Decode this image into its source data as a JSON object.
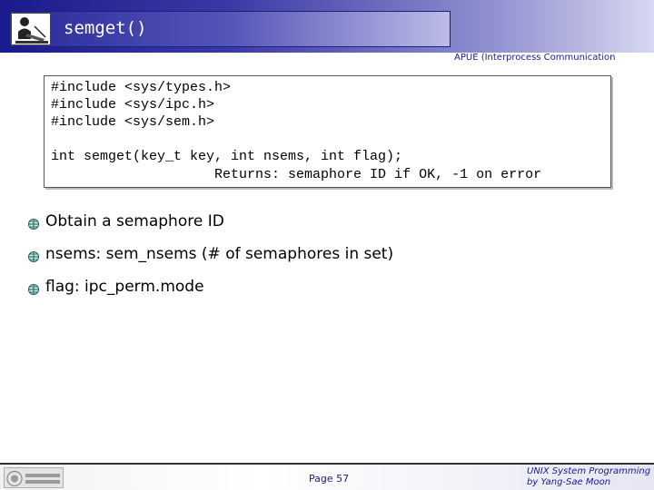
{
  "header": {
    "title": "semget()",
    "subtitle": "APUE (Interprocess Communication"
  },
  "code": {
    "lines": [
      "#include <sys/types.h>",
      "#include <sys/ipc.h>",
      "#include <sys/sem.h>",
      "int semget(key_t key, int nsems, int flag);",
      "                    Returns: semaphore ID if OK, -1 on error"
    ]
  },
  "bullets": [
    "Obtain a semaphore ID",
    "nsems: sem_nsems (# of semaphores in set)",
    "flag: ipc_perm.mode"
  ],
  "footer": {
    "page": "Page 57",
    "course": "UNIX System Programming",
    "author": "by Yang-Sae Moon"
  },
  "colors": {
    "accent": "#1a1a8c",
    "bullet_icon": "#1a5f5a"
  },
  "icons": {
    "bullet": "globe-bullet-icon",
    "header_logo": "person-at-desk-icon",
    "footer_logo": "university-logo-icon"
  }
}
